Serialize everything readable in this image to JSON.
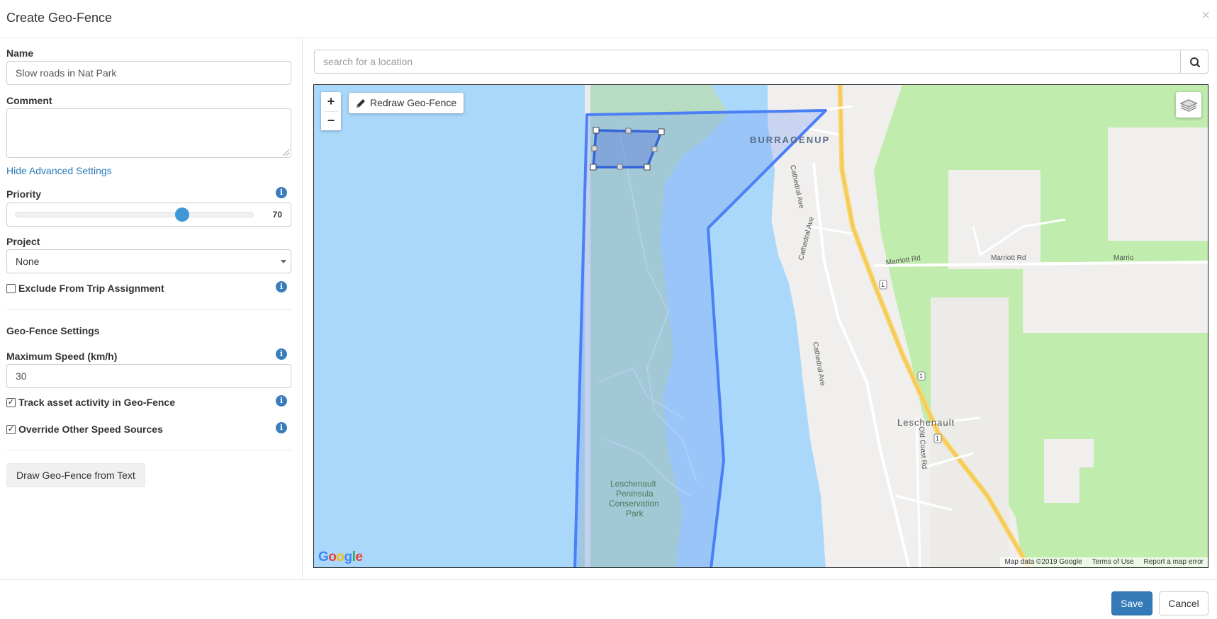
{
  "dialog": {
    "title": "Create Geo-Fence",
    "close_glyph": "×"
  },
  "form": {
    "name_label": "Name",
    "name_value": "Slow roads in Nat Park",
    "comment_label": "Comment",
    "comment_value": "",
    "advanced_link": "Hide Advanced Settings",
    "priority_label": "Priority",
    "priority_value": "70",
    "priority_fraction": 0.7,
    "project_label": "Project",
    "project_value": "None",
    "exclude_label": "Exclude From Trip Assignment",
    "exclude_checked": false,
    "geofence_section": "Geo-Fence Settings",
    "max_speed_label": "Maximum Speed (km/h)",
    "max_speed_value": "30",
    "track_label": "Track asset activity in Geo-Fence",
    "track_checked": true,
    "override_label": "Override Other Speed Sources",
    "override_checked": true,
    "draw_text_button": "Draw Geo-Fence from Text"
  },
  "map": {
    "search_placeholder": "search for a location",
    "zoom_in": "+",
    "zoom_out": "−",
    "redraw_button": "Redraw Geo-Fence",
    "labels": {
      "burragenup": "BURRAGENUP",
      "leschenault": "Leschenault",
      "park_line1": "Leschenault",
      "park_line2": "Peninsula",
      "park_line3": "Conservation",
      "park_line4": "Park",
      "cathedral_1": "Cathedral Ave",
      "cathedral_2": "Cathedral Ave",
      "cathedral_3": "Cathedral Ave",
      "marriott_1": "Marriott Rd",
      "marriott_2": "Marriott Rd",
      "marriott_3": "Marrio",
      "old_coast": "Old Coast Rd",
      "route_1": "1"
    },
    "google": [
      "G",
      "o",
      "o",
      "g",
      "l",
      "e"
    ],
    "footer": {
      "data": "Map data ©2019 Google",
      "terms": "Terms of Use",
      "report": "Report a map error"
    },
    "colors": {
      "water": "#aad8fb",
      "land": "#f0efed",
      "park": "#c0ecae",
      "fence_stroke": "#4a7ff5",
      "fence_fill": "#7da4f5"
    }
  },
  "footer": {
    "save": "Save",
    "cancel": "Cancel"
  },
  "icons": {
    "info": "i",
    "check": "✓"
  }
}
